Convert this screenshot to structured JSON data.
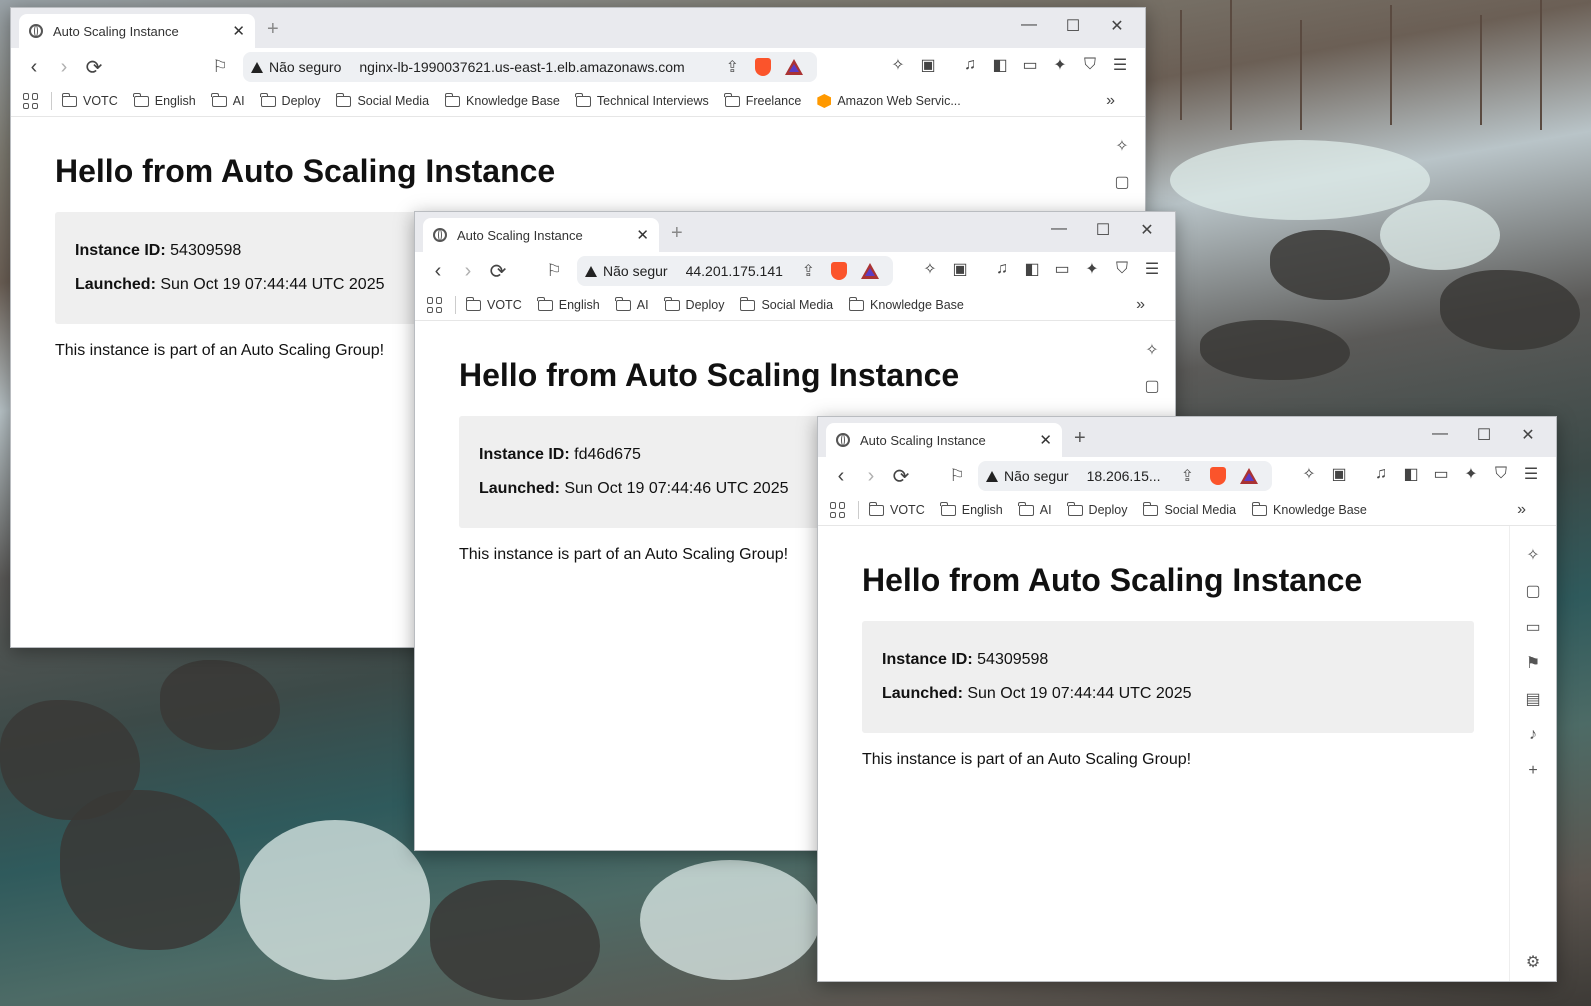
{
  "windows": [
    {
      "tab_title": "Auto Scaling Instance",
      "security": "Não seguro",
      "url": "nginx-lb-1990037621.us-east-1.elb.amazonaws.com",
      "bookmarks": [
        "VOTC",
        "English",
        "AI",
        "Deploy",
        "Social Media",
        "Knowledge Base",
        "Technical Interviews",
        "Freelance"
      ],
      "aws_bookmark": "Amazon Web Servic...",
      "heading": "Hello from Auto Scaling Instance",
      "instance_label": "Instance ID:",
      "instance_id": "54309598",
      "launched_label": "Launched:",
      "launched": "Sun Oct 19 07:44:44 UTC 2025",
      "tagline": "This instance is part of an Auto Scaling Group!"
    },
    {
      "tab_title": "Auto Scaling Instance",
      "security": "Não segur",
      "url": "44.201.175.141",
      "bookmarks": [
        "VOTC",
        "English",
        "AI",
        "Deploy",
        "Social Media",
        "Knowledge Base"
      ],
      "heading": "Hello from Auto Scaling Instance",
      "instance_label": "Instance ID:",
      "instance_id": "fd46d675",
      "launched_label": "Launched:",
      "launched": "Sun Oct 19 07:44:46 UTC 2025",
      "tagline": "This instance is part of an Auto Scaling Group!"
    },
    {
      "tab_title": "Auto Scaling Instance",
      "security": "Não segur",
      "url": "18.206.15...",
      "bookmarks": [
        "VOTC",
        "English",
        "AI",
        "Deploy",
        "Social Media",
        "Knowledge Base"
      ],
      "heading": "Hello from Auto Scaling Instance",
      "instance_label": "Instance ID:",
      "instance_id": "54309598",
      "launched_label": "Launched:",
      "launched": "Sun Oct 19 07:44:44 UTC 2025",
      "tagline": "This instance is part of an Auto Scaling Group!"
    }
  ],
  "icons": {
    "back": "‹",
    "forward": "›",
    "reload": "⟳",
    "close": "✕",
    "minimize": "—",
    "maximize": "☐",
    "new_tab": "+",
    "more": "»"
  }
}
